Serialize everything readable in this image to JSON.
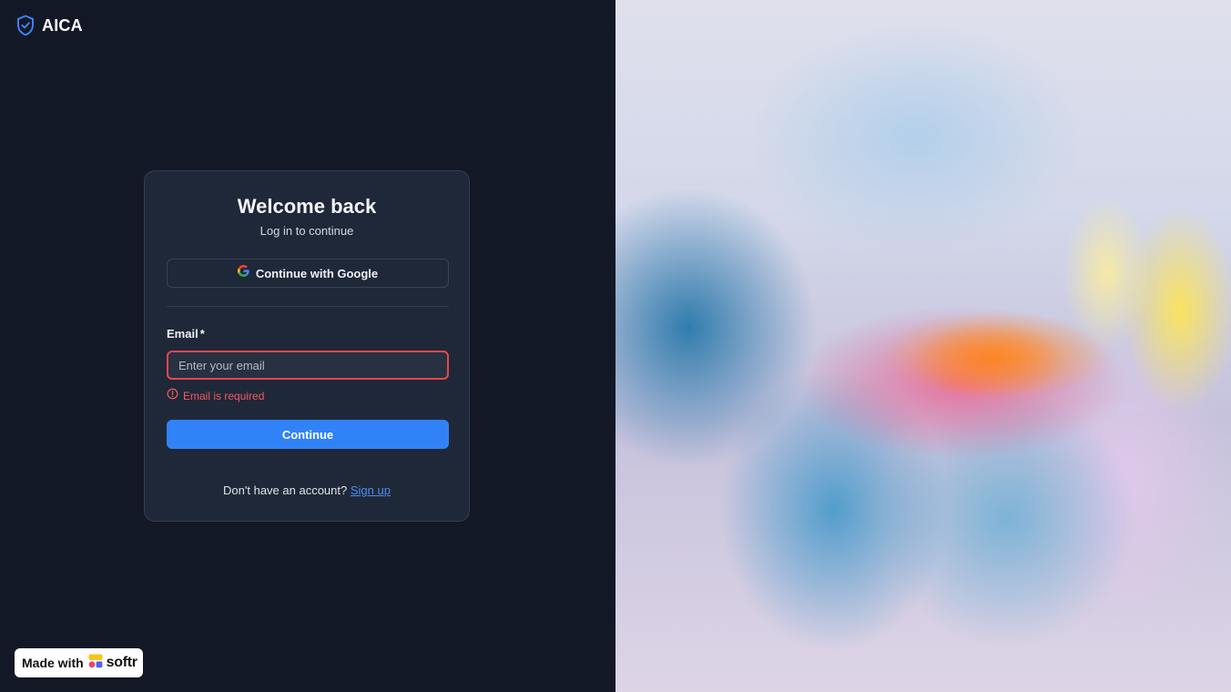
{
  "brand": {
    "name": "AICA",
    "icon": "shield-check-icon",
    "accent": "#3b82f6"
  },
  "login_card": {
    "title": "Welcome back",
    "subtitle": "Log in to continue",
    "google_button": {
      "label": "Continue with Google",
      "icon": "google-g-icon"
    },
    "email": {
      "label": "Email",
      "required_marker": "*",
      "value": "",
      "placeholder": "Enter your email",
      "error": "Email is required",
      "error_icon": "alert-circle-icon"
    },
    "continue_button": {
      "label": "Continue"
    },
    "signup": {
      "prompt": "Don't have an account?",
      "link_label": "Sign up"
    }
  },
  "badge": {
    "made_with_label": "Made with",
    "brand_text": "softr",
    "icon": "softr-logo-icon"
  },
  "colors": {
    "background": "#131826",
    "card": "#1f2838",
    "primary": "#3182f6",
    "error": "#e5484d",
    "link": "#4b8ef0"
  }
}
